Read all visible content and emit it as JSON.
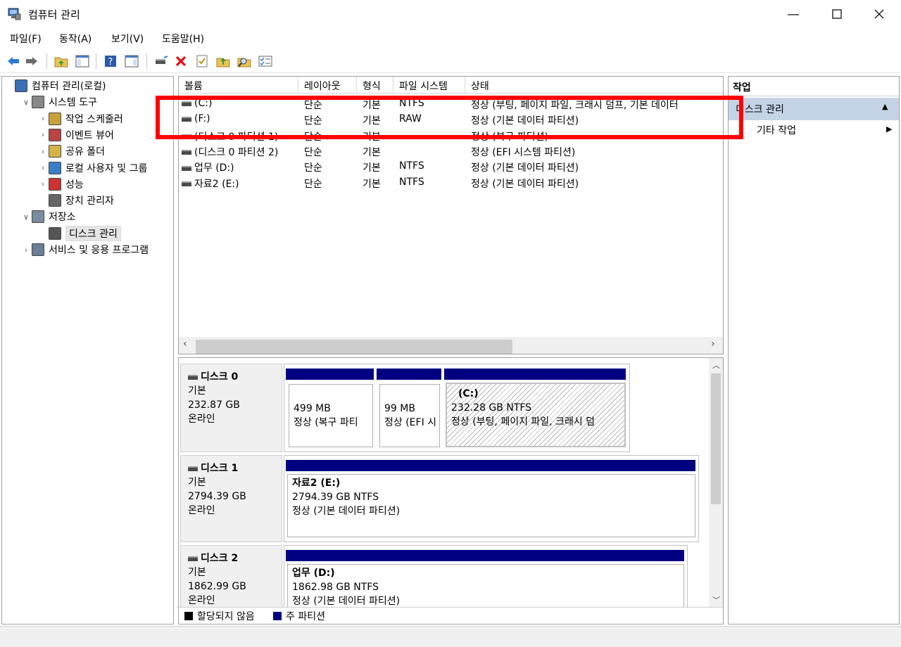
{
  "window": {
    "title": "컴퓨터 관리"
  },
  "menu": [
    "파일(F)",
    "동작(A)",
    "보기(V)",
    "도움말(H)"
  ],
  "tree": [
    {
      "label": "컴퓨터 관리(로컬)",
      "indent": 0,
      "exp": "",
      "icon": "computer-management-icon"
    },
    {
      "label": "시스템 도구",
      "indent": 1,
      "exp": "∨",
      "icon": "system-tools-icon"
    },
    {
      "label": "작업 스케줄러",
      "indent": 2,
      "exp": "›",
      "icon": "clock-icon"
    },
    {
      "label": "이벤트 뷰어",
      "indent": 2,
      "exp": "›",
      "icon": "event-viewer-icon"
    },
    {
      "label": "공유 폴더",
      "indent": 2,
      "exp": "›",
      "icon": "shared-folder-icon"
    },
    {
      "label": "로컬 사용자 및 그룹",
      "indent": 2,
      "exp": "›",
      "icon": "users-icon"
    },
    {
      "label": "성능",
      "indent": 2,
      "exp": "›",
      "icon": "performance-icon"
    },
    {
      "label": "장치 관리자",
      "indent": 2,
      "exp": "",
      "icon": "device-manager-icon"
    },
    {
      "label": "저장소",
      "indent": 1,
      "exp": "∨",
      "icon": "storage-icon"
    },
    {
      "label": "디스크 관리",
      "indent": 2,
      "exp": "",
      "icon": "disk-management-icon",
      "selected": true
    },
    {
      "label": "서비스 및 응용 프로그램",
      "indent": 1,
      "exp": "›",
      "icon": "services-icon"
    }
  ],
  "volume_table": {
    "headers": [
      "볼륨",
      "레이아웃",
      "형식",
      "파일 시스템",
      "상태"
    ],
    "rows": [
      {
        "vol": "(C:)",
        "layout": "단순",
        "type": "기본",
        "fs": "NTFS",
        "status": "정상 (부팅, 페이지 파일, 크래시 덤프, 기본 데이터"
      },
      {
        "vol": "(F:)",
        "layout": "단순",
        "type": "기본",
        "fs": "RAW",
        "status": "정상 (기본 데이터 파티션)"
      },
      {
        "vol": "(디스크 0 파티션 1)",
        "layout": "단순",
        "type": "기본",
        "fs": "",
        "status": "정상 (복구 파티션)"
      },
      {
        "vol": "(디스크 0 파티션 2)",
        "layout": "단순",
        "type": "기본",
        "fs": "",
        "status": "정상 (EFI 시스템 파티션)"
      },
      {
        "vol": "업무 (D:)",
        "layout": "단순",
        "type": "기본",
        "fs": "NTFS",
        "status": "정상 (기본 데이터 파티션)"
      },
      {
        "vol": "자료2 (E:)",
        "layout": "단순",
        "type": "기본",
        "fs": "NTFS",
        "status": "정상 (기본 데이터 파티션)"
      }
    ]
  },
  "disks": {
    "d0": {
      "name": "디스크 0",
      "type": "기본",
      "size": "232.87 GB",
      "state": "온라인",
      "p1": {
        "size": "499 MB",
        "status": "정상 (복구 파티"
      },
      "p2": {
        "size": "99 MB",
        "status": "정상 (EFI 시"
      },
      "p3": {
        "name": "(C:)",
        "size": "232.28 GB NTFS",
        "status": "정상 (부팅, 페이지 파일, 크래시 덤"
      }
    },
    "d1": {
      "name": "디스크 1",
      "type": "기본",
      "size": "2794.39 GB",
      "state": "온라인",
      "p1": {
        "name": "자료2  (E:)",
        "size": "2794.39 GB NTFS",
        "status": "정상 (기본 데이터 파티션)"
      }
    },
    "d2": {
      "name": "디스크 2",
      "type": "기본",
      "size": "1862.99 GB",
      "state": "온라인",
      "p1": {
        "name": "업무  (D:)",
        "size": "1862.98 GB NTFS",
        "status": "정상 (기본 데이터 파티션)"
      }
    }
  },
  "legend": {
    "unallocated": "할당되지 않음",
    "primary": "주 파티션"
  },
  "actions": {
    "title": "작업",
    "section": "디스크 관리",
    "more": "기타 작업"
  },
  "colors": {
    "primary_partition": "#000080",
    "highlight": "#ff0000",
    "action_section": "#c4d4e6"
  }
}
